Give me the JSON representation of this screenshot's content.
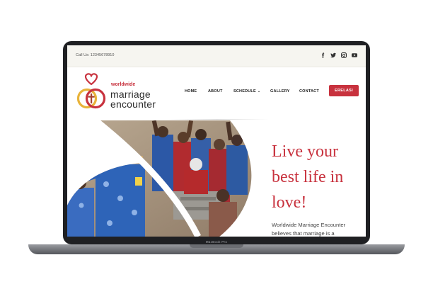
{
  "topbar": {
    "call_text": "Call Us: 12345678910",
    "social_icons": [
      "facebook-icon",
      "twitter-icon",
      "instagram-icon",
      "youtube-icon"
    ]
  },
  "brand": {
    "small": "worldwide",
    "line1": "marriage",
    "line2": "encounter"
  },
  "nav": {
    "home": "HOME",
    "about": "ABOUT",
    "schedule": "SCHEDULE",
    "gallery": "GALLERY",
    "contact": "CONTACT",
    "cta": "ERELASI"
  },
  "hero": {
    "headline_1": "Live your",
    "headline_2": "best life in",
    "headline_3": "love!",
    "body": "Worldwide Marriage Encounter believes that marriage is a"
  },
  "device": {
    "model_label": "MacBook Pro"
  },
  "colors": {
    "accent": "#c8323e",
    "gold": "#e8b33a",
    "topbar_bg": "#f6f5f0"
  }
}
